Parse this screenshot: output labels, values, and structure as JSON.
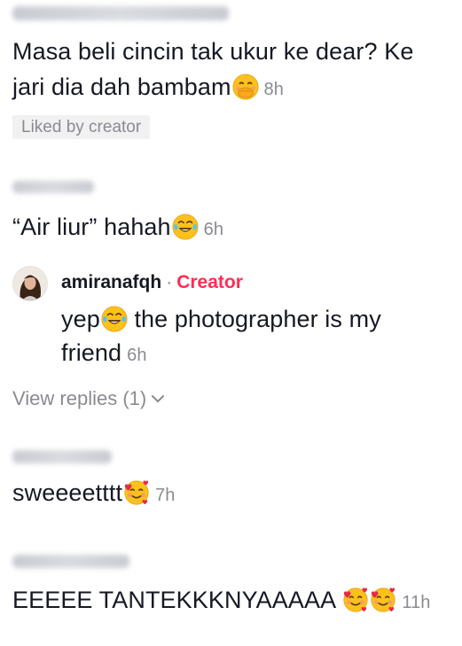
{
  "comments": [
    {
      "text_line1": "Masa beli cincin tak ukur ke dear? Ke",
      "text_line2": "jari dia dah bambam",
      "emoji": "hand-over-mouth-emoji",
      "time": "8h",
      "badge": "Liked by creator"
    },
    {
      "text": "“Air liur” hahah",
      "emoji": "tears-of-joy-emoji",
      "time": "6h"
    },
    {
      "username": "amiranafqh",
      "separator": "·",
      "creator_label": "Creator",
      "text_part1": "yep",
      "text_part2": " the photographer is my",
      "text_line2": "friend",
      "emoji": "tears-of-joy-emoji",
      "time": "6h",
      "view_replies": "View replies (1)"
    },
    {
      "text": "sweeeetttt",
      "emoji": "smiling-face-with-hearts-emoji",
      "time": "7h"
    },
    {
      "text": "EEEEE TANTEKKKNYAAAAA ",
      "emoji": "smiling-face-with-hearts-emoji",
      "time": "11h"
    }
  ],
  "colors": {
    "text": "#161823",
    "secondary": "#8a8b91",
    "creator_accent": "#fe2c55",
    "badge_bg": "#f1f1f2"
  }
}
